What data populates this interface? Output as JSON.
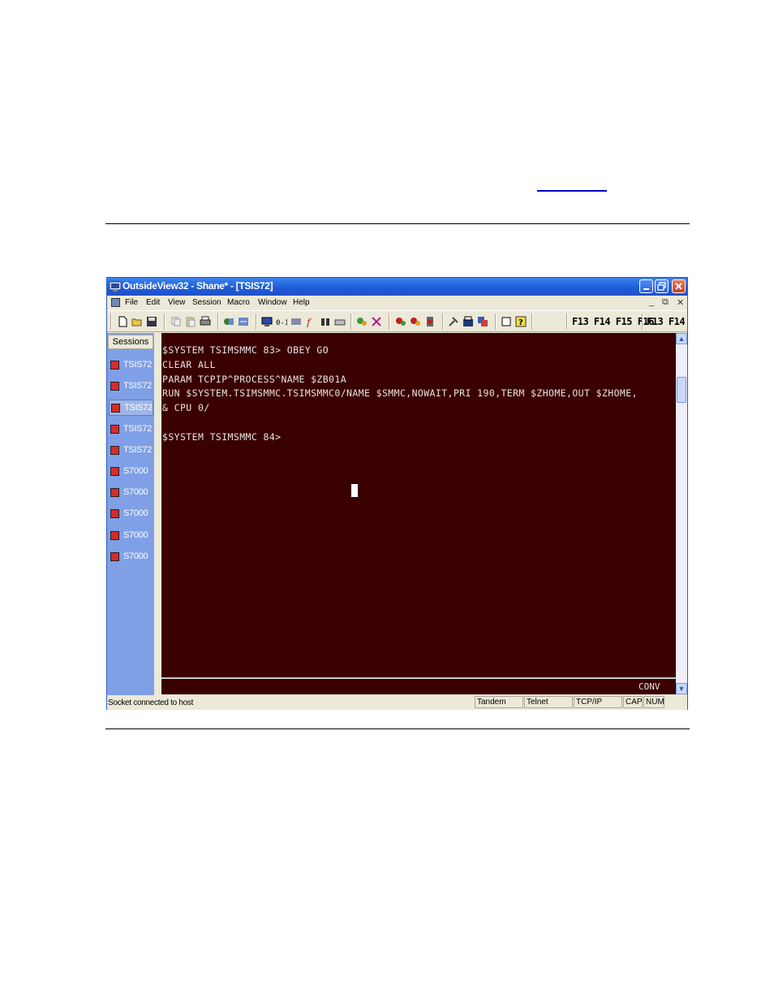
{
  "window": {
    "title": "OutsideView32 - Shane* - [TSIS72]"
  },
  "menu": {
    "items": [
      "File",
      "Edit",
      "View",
      "Session",
      "Macro",
      "Window",
      "Help"
    ]
  },
  "toolbar": {
    "function_keys_a": "F13 F14 F15 F16",
    "function_keys_b": "F13 F14"
  },
  "sidebar": {
    "header": "Sessions",
    "sessions": [
      "TSIS72",
      "TSIS72",
      "TSIS72",
      "TSIS72",
      "TSIS72",
      "S7000",
      "S7000",
      "S7000",
      "S7000",
      "S7000"
    ],
    "active_index": 2
  },
  "terminal": {
    "lines": [
      "$SYSTEM TSIMSMMC 83> OBEY GO",
      "CLEAR ALL",
      "PARAM TCPIP^PROCESS^NAME $ZB01A",
      "RUN $SYSTEM.TSIMSMMC.TSIMSMMC0/NAME $SMMC,NOWAIT,PRI 190,TERM $ZHOME,OUT $ZHOME,",
      "& CPU 0/",
      "",
      "$SYSTEM TSIMSMMC 84>"
    ],
    "status": "CONV",
    "background": "#3a0000"
  },
  "statusbar": {
    "message": "Socket connected to host",
    "panels": [
      "Tandem",
      "Telnet",
      "TCP/IP",
      "CAP",
      "NUM"
    ]
  }
}
